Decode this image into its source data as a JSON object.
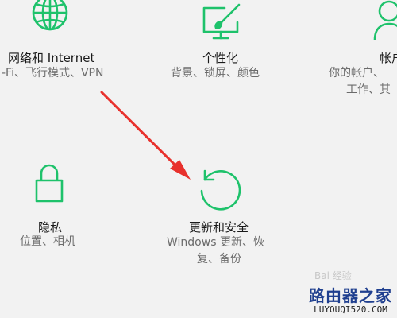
{
  "settings": {
    "tiles": [
      {
        "title": "网络和 Internet",
        "desc": [
          "-Fi、飞行模式、VPN"
        ]
      },
      {
        "title": "个性化",
        "desc": [
          "背景、锁屏、颜色"
        ]
      },
      {
        "title": "帐户",
        "desc": [
          "你的帐户、",
          "工作、其"
        ]
      },
      {
        "title": "隐私",
        "desc": [
          "位置、相机"
        ]
      },
      {
        "title": "更新和安全",
        "desc": [
          "Windows 更新、恢",
          "复、备份"
        ]
      }
    ]
  },
  "watermark": {
    "line1": "路由器之家",
    "line2": "LUYOUQI520.COM",
    "baidu": "Bai 经验"
  },
  "colors": {
    "accent": "#1ec26b",
    "arrow": "#e8312d"
  },
  "icons": [
    "globe-icon",
    "personalization-icon",
    "person-icon",
    "lock-icon",
    "update-icon"
  ]
}
